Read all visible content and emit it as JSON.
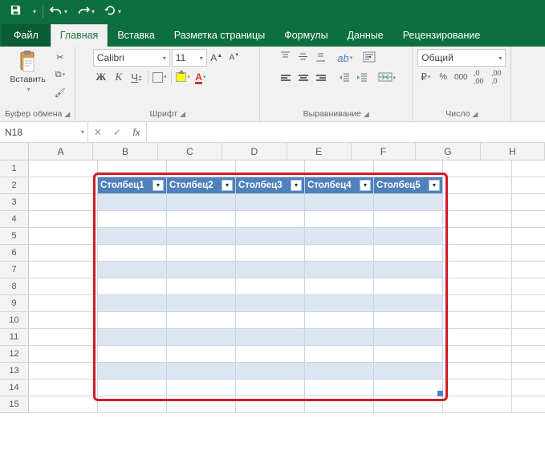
{
  "qat": {
    "save": "💾",
    "undo": "↶",
    "redo": "↷",
    "repeat": "↻"
  },
  "tabs": {
    "file": "Файл",
    "items": [
      "Главная",
      "Вставка",
      "Разметка страницы",
      "Формулы",
      "Данные",
      "Рецензирование"
    ],
    "active_index": 0
  },
  "ribbon": {
    "clipboard": {
      "label": "Буфер обмена",
      "paste": "Вставить"
    },
    "font": {
      "label": "Шрифт",
      "name": "Calibri",
      "size": "11",
      "bold": "Ж",
      "italic": "К",
      "underline": "Ч"
    },
    "alignment": {
      "label": "Выравнивание"
    },
    "number": {
      "label": "Число",
      "format": "Общий"
    }
  },
  "namebox": "N18",
  "formula": "",
  "grid": {
    "columns": [
      "A",
      "B",
      "C",
      "D",
      "E",
      "F",
      "G",
      "H"
    ],
    "rows": [
      1,
      2,
      3,
      4,
      5,
      6,
      7,
      8,
      9,
      10,
      11,
      12,
      13,
      14,
      15
    ]
  },
  "table": {
    "start_col": 1,
    "start_row": 1,
    "headers": [
      "Столбец1",
      "Столбец2",
      "Столбец3",
      "Столбец4",
      "Столбец5"
    ],
    "body_rows": 12
  },
  "chart_data": null
}
